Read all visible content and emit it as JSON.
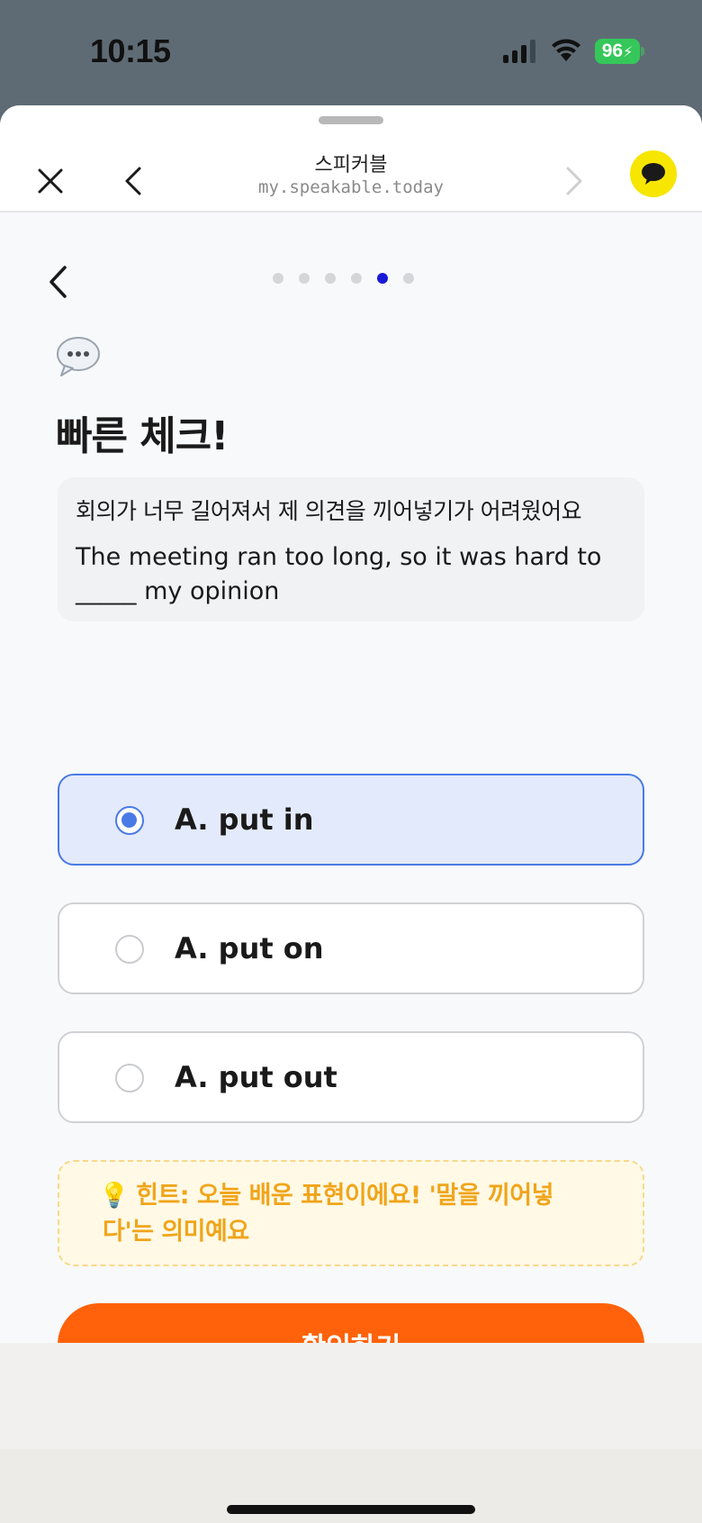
{
  "status_bar": {
    "time": "10:15",
    "battery": "96"
  },
  "browser": {
    "site_title": "스피커블",
    "site_url": "my.speakable.today"
  },
  "quiz": {
    "progress": {
      "total": 6,
      "current": 5
    },
    "title": "빠른 체크!",
    "question_korean": "회의가 너무 길어져서 제 의견을 끼어넣기가 어려웠어요",
    "question_english": "The meeting ran too long, so it was hard to _____ my opinion",
    "options": [
      {
        "label": "A. put in",
        "selected": true
      },
      {
        "label": "A. put on",
        "selected": false
      },
      {
        "label": "A. put out",
        "selected": false
      }
    ],
    "hint": "힌트: 오늘 배운 표현이에요! '말을 끼어넣다'는 의미예요",
    "confirm_label": "확인하기"
  },
  "icons": {
    "close": "close-icon",
    "back": "chevron-left-icon",
    "forward": "chevron-right-icon",
    "chat": "kakao-chat-icon",
    "speech": "speech-bubble-icon",
    "hint": "lightbulb-icon"
  },
  "colors": {
    "accent": "#ff620a",
    "selected_border": "#4a7ae6",
    "selected_bg": "#e3eafb",
    "hint_text": "#f0a51a",
    "progress_active": "#1a1ad6"
  }
}
